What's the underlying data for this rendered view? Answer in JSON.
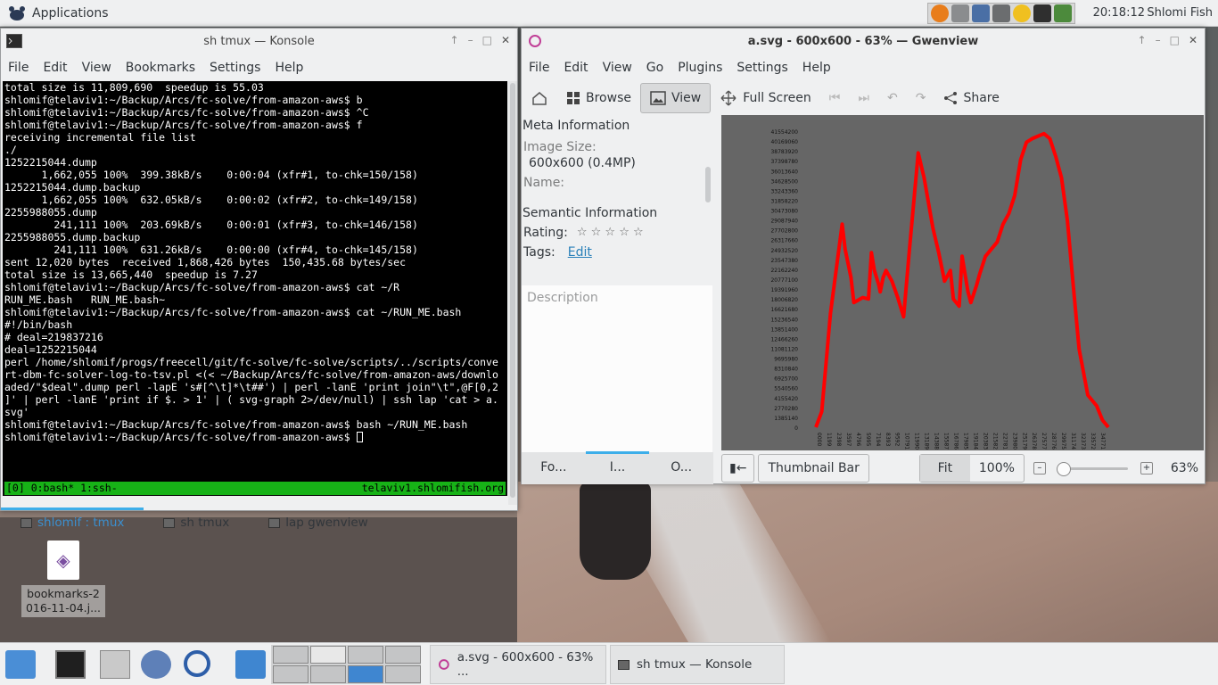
{
  "top_panel": {
    "app_menu": "Applications",
    "clock": "20:18:12",
    "user": "Shlomi Fish"
  },
  "konsole": {
    "title": "sh tmux — Konsole",
    "menu": [
      "File",
      "Edit",
      "View",
      "Bookmarks",
      "Settings",
      "Help"
    ],
    "terminal_lines": [
      "total size is 11,809,690  speedup is 55.03",
      "shlomif@telaviv1:~/Backup/Arcs/fc-solve/from-amazon-aws$ b",
      "shlomif@telaviv1:~/Backup/Arcs/fc-solve/from-amazon-aws$ ^C",
      "shlomif@telaviv1:~/Backup/Arcs/fc-solve/from-amazon-aws$ f",
      "receiving incremental file list",
      "./",
      "1252215044.dump",
      "      1,662,055 100%  399.38kB/s    0:00:04 (xfr#1, to-chk=150/158)",
      "1252215044.dump.backup",
      "      1,662,055 100%  632.05kB/s    0:00:02 (xfr#2, to-chk=149/158)",
      "2255988055.dump",
      "        241,111 100%  203.69kB/s    0:00:01 (xfr#3, to-chk=146/158)",
      "2255988055.dump.backup",
      "        241,111 100%  631.26kB/s    0:00:00 (xfr#4, to-chk=145/158)",
      "",
      "sent 12,020 bytes  received 1,868,426 bytes  150,435.68 bytes/sec",
      "total size is 13,665,440  speedup is 7.27",
      "shlomif@telaviv1:~/Backup/Arcs/fc-solve/from-amazon-aws$ cat ~/R",
      "RUN_ME.bash   RUN_ME.bash~",
      "shlomif@telaviv1:~/Backup/Arcs/fc-solve/from-amazon-aws$ cat ~/RUN_ME.bash",
      "#!/bin/bash",
      "# deal=219837216",
      "deal=1252215044",
      "perl /home/shlomif/progs/freecell/git/fc-solve/fc-solve/scripts/../scripts/conve",
      "rt-dbm-fc-solver-log-to-tsv.pl <(< ~/Backup/Arcs/fc-solve/from-amazon-aws/downlo",
      "aded/\"$deal\".dump perl -lapE 's#[^\\t]*\\t##') | perl -lanE 'print join\"\\t\",@F[0,2",
      "]' | perl -lanE 'print if $. > 1' | ( svg-graph 2>/dev/null) | ssh lap 'cat > a.",
      "svg'",
      "shlomif@telaviv1:~/Backup/Arcs/fc-solve/from-amazon-aws$ bash ~/RUN_ME.bash",
      "shlomif@telaviv1:~/Backup/Arcs/fc-solve/from-amazon-aws$ "
    ],
    "status_left": "[0] 0:bash* 1:ssh-",
    "status_right": "telaviv1.shlomifish.org",
    "tabs": [
      "shlomif : tmux",
      "sh tmux",
      "lap gwenview"
    ]
  },
  "gwenview": {
    "title": "a.svg - 600x600 - 63% — Gwenview",
    "menu": [
      "File",
      "Edit",
      "View",
      "Go",
      "Plugins",
      "Settings",
      "Help"
    ],
    "toolbar": {
      "browse": "Browse",
      "view": "View",
      "fullscreen": "Full Screen",
      "share": "Share"
    },
    "meta_header": "Meta Information",
    "image_size_label": "Image Size:",
    "image_size_value": "600x600 (0.4MP)",
    "name_label": "Name:",
    "semantic_header": "Semantic Information",
    "rating_label": "Rating:",
    "rating_stars": "☆ ☆ ☆ ☆ ☆",
    "tags_label": "Tags:",
    "tags_edit": "Edit",
    "description_placeholder": "Description",
    "sidebar_tabs": [
      "Fo...",
      "I...",
      "O..."
    ],
    "thumbnail_bar": "Thumbnail Bar",
    "fit": "Fit",
    "zoom100": "100%",
    "zoom_value": "63%",
    "zoom_level": 0
  },
  "desktop_icon": {
    "label_line1": "bookmarks-2",
    "label_line2": "016-11-04.j..."
  },
  "taskbar": {
    "tasks": [
      "a.svg - 600x600 - 63% ...",
      "sh tmux — Konsole"
    ]
  },
  "colors": {
    "plot_line": "#ff0000",
    "term_status": "#17b217",
    "accent": "#3daee9"
  },
  "chart_data": {
    "type": "line",
    "yticks": [
      "41554200",
      "40169060",
      "38783920",
      "37398780",
      "36013640",
      "34628500",
      "33243360",
      "31858220",
      "30473080",
      "29087940",
      "27702800",
      "26317660",
      "24932520",
      "23547380",
      "22162240",
      "20777100",
      "19391960",
      "18006820",
      "16621680",
      "15236540",
      "13851400",
      "12466260",
      "11081120",
      "9695980",
      "8310840",
      "6925700",
      "5540560",
      "4155420",
      "2770280",
      "1385140",
      "0"
    ],
    "xticks": [
      "0000",
      "1199",
      "2398",
      "3597",
      "4796",
      "5995",
      "7194",
      "8393",
      "9592",
      "10791",
      "11990",
      "13189",
      "14388",
      "15587",
      "16786",
      "17985",
      "19184",
      "20383",
      "21582",
      "22781",
      "23980",
      "25179",
      "26378",
      "27577",
      "28776",
      "29975",
      "31174",
      "32373",
      "33572",
      "34771"
    ],
    "ylim": [
      0,
      41554200
    ],
    "x": [
      0,
      0.02,
      0.05,
      0.09,
      0.1,
      0.12,
      0.13,
      0.16,
      0.18,
      0.19,
      0.2,
      0.215,
      0.22,
      0.23,
      0.24,
      0.26,
      0.28,
      0.3,
      0.32,
      0.35,
      0.37,
      0.4,
      0.42,
      0.44,
      0.46,
      0.47,
      0.49,
      0.5,
      0.52,
      0.53,
      0.55,
      0.56,
      0.58,
      0.62,
      0.64,
      0.66,
      0.68,
      0.7,
      0.72,
      0.74,
      0.78,
      0.8,
      0.82,
      0.84,
      0.86,
      0.88,
      0.9,
      0.93,
      0.96,
      0.98,
      1.0
    ],
    "values": [
      0,
      2200000,
      16000000,
      28500000,
      25000000,
      21000000,
      17500000,
      18200000,
      18000000,
      24500000,
      22000000,
      20000000,
      19000000,
      21000000,
      22000000,
      20500000,
      18200000,
      15500000,
      25000000,
      38500000,
      35000000,
      28000000,
      24500000,
      20500000,
      22000000,
      18000000,
      17000000,
      24000000,
      19000000,
      17500000,
      20000000,
      21500000,
      24000000,
      26000000,
      28500000,
      30000000,
      32500000,
      37500000,
      40000000,
      40500000,
      41200000,
      40500000,
      38000000,
      35000000,
      29000000,
      20000000,
      11000000,
      4500000,
      3000000,
      1000000,
      0
    ]
  }
}
